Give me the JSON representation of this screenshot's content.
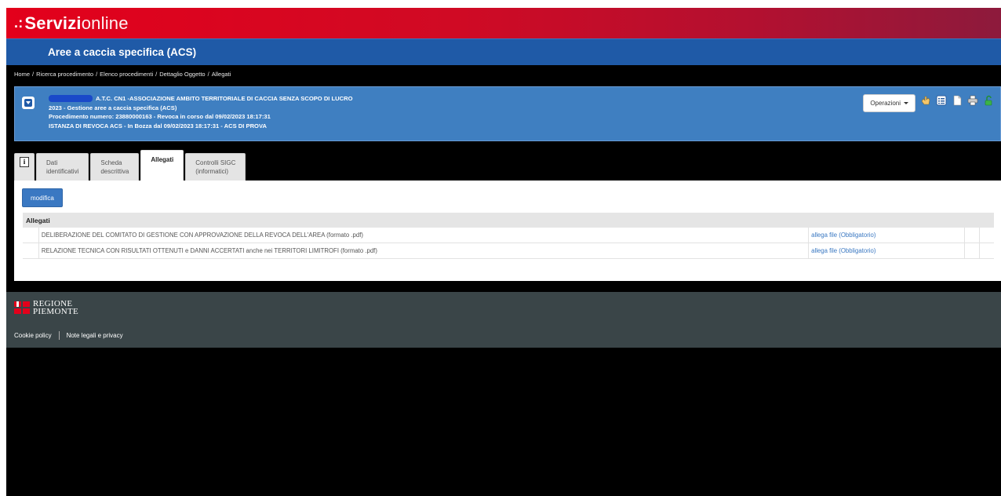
{
  "brand": {
    "dots": ".:",
    "strong": "Servizi",
    "light": "online"
  },
  "app": {
    "title": "Aree a caccia specifica (ACS)"
  },
  "breadcrumb": [
    "Home",
    "Ricerca procedimento",
    "Elenco procedimenti",
    "Dettaglio Oggetto",
    "Allegati"
  ],
  "info": {
    "line1": "A.T.C. CN1 -ASSOCIAZIONE AMBITO TERRITORIALE DI CACCIA SENZA SCOPO DI LUCRO",
    "line2": "2023 - Gestione aree a caccia specifica (ACS)",
    "line3": "Procedimento numero: 23880000163 - Revoca in corso dal 09/02/2023 18:17:31",
    "line4": "ISTANZA DI REVOCA ACS - In Bozza dal 09/02/2023 18:17:31 - ACS DI PROVA"
  },
  "operations": {
    "label": "Operazioni"
  },
  "toolbar_icons": [
    "hand-icon",
    "list-icon",
    "document-icon",
    "print-icon",
    "unlock-icon"
  ],
  "tabs": [
    {
      "line1": "Dati",
      "line2": "identificativi"
    },
    {
      "line1": "Scheda",
      "line2": "descrittiva"
    },
    {
      "line1": "Allegati",
      "line2": ""
    },
    {
      "line1": "Controlli SIGC",
      "line2": "(informatici)"
    }
  ],
  "content": {
    "modifica_label": "modifica",
    "table_header": "Allegati",
    "rows": [
      {
        "desc": "DELIBERAZIONE DEL COMITATO DI GESTIONE CON APPROVAZIONE DELLA REVOCA DELL'AREA (formato .pdf)",
        "link": "allega file (Obbligatorio)"
      },
      {
        "desc": "RELAZIONE TECNICA CON RISULTATI OTTENUTI e DANNI ACCERTATI anche nei TERRITORI LIMITROFI (formato .pdf)",
        "link": "allega file (Obbligatorio)"
      }
    ]
  },
  "footer": {
    "logo_line1": "REGIONE",
    "logo_line2": "PIEMONTE",
    "cookie": "Cookie policy",
    "legal": "Note legali e privacy"
  },
  "colors": {
    "brand_red": "#e3001b",
    "app_blue": "#1f5aa7",
    "panel_blue": "#3f7fc1",
    "footer": "#3a4548"
  }
}
